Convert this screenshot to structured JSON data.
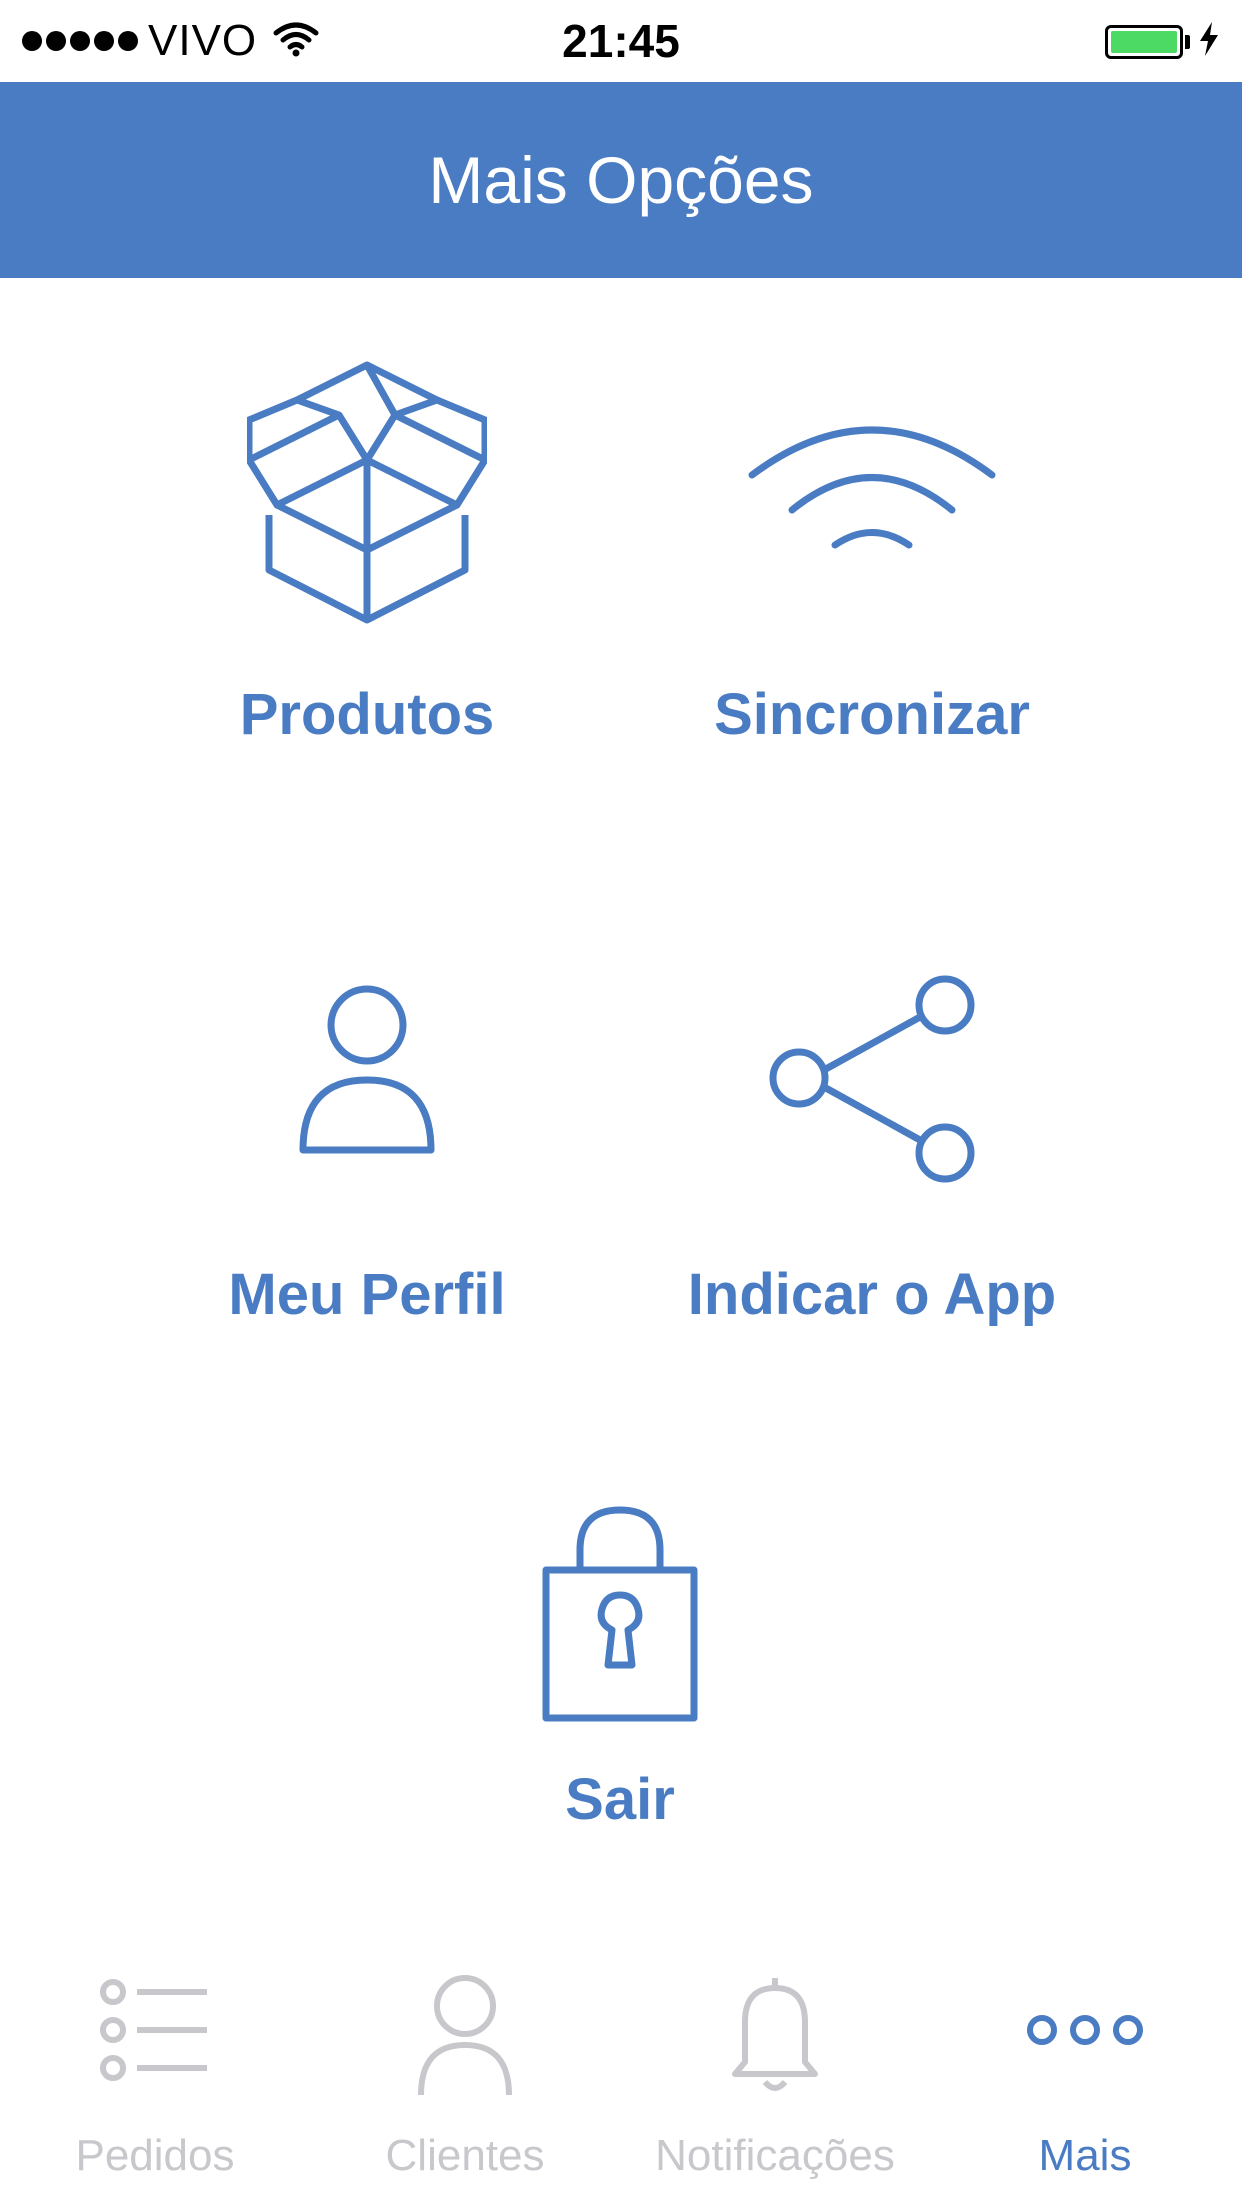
{
  "status_bar": {
    "carrier": "VIVO",
    "time": "21:45",
    "signal_icon": "signal-dots-icon",
    "wifi_icon": "wifi-icon",
    "battery_icon": "battery-icon",
    "charging_icon": "charging-bolt-icon"
  },
  "nav": {
    "title": "Mais Opções"
  },
  "options": [
    {
      "label": "Produtos",
      "icon": "box-icon"
    },
    {
      "label": "Sincronizar",
      "icon": "sync-wifi-icon"
    },
    {
      "label": "Meu Perfil",
      "icon": "user-icon"
    },
    {
      "label": "Indicar o App",
      "icon": "share-icon"
    },
    {
      "label": "Sair",
      "icon": "lock-icon"
    }
  ],
  "tabs": [
    {
      "label": "Pedidos",
      "icon": "list-icon",
      "active": false
    },
    {
      "label": "Clientes",
      "icon": "user-icon",
      "active": false
    },
    {
      "label": "Notificações",
      "icon": "bell-icon",
      "active": false
    },
    {
      "label": "Mais",
      "icon": "more-icon",
      "active": true
    }
  ],
  "colors": {
    "accent": "#4a7cc3",
    "inactive_tab": "#c7c7cc",
    "battery": "#4cd964",
    "background": "#ffffff"
  }
}
